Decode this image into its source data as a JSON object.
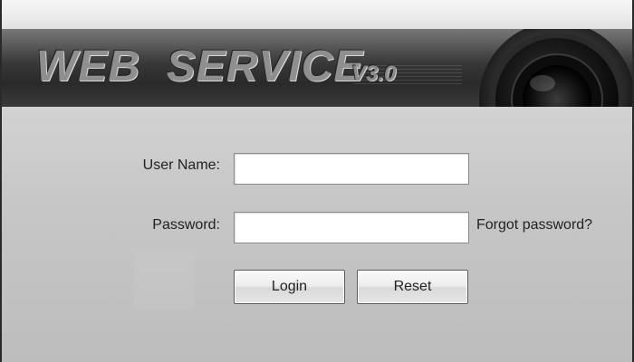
{
  "header": {
    "title": "WEB  SERVICE",
    "version": "V3.0"
  },
  "login_form": {
    "username_label": "User Name:",
    "username_value": "",
    "password_label": "Password:",
    "password_value": "",
    "forgot_password_link": "Forgot password?",
    "login_button": "Login",
    "reset_button": "Reset"
  },
  "icons": {
    "banner_decoration": "camera-lens-icon"
  }
}
